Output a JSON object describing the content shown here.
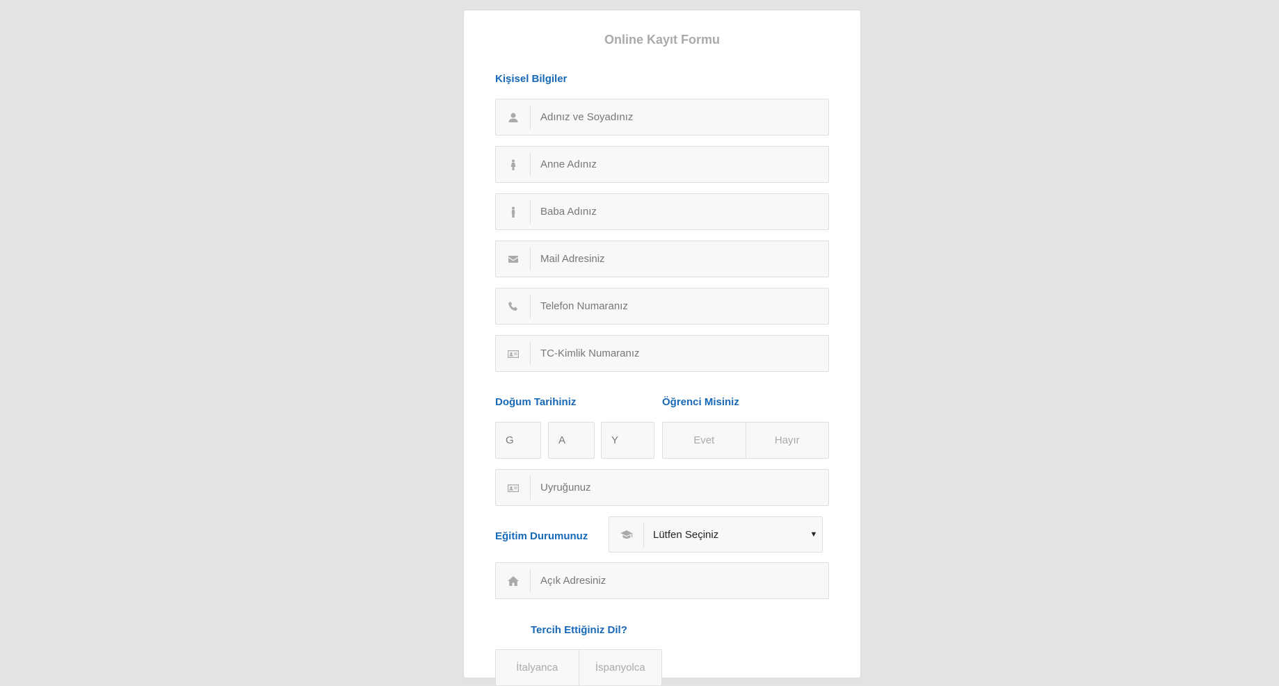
{
  "form": {
    "title": "Online Kayıt Formu",
    "personal_section": "Kişisel Bilgiler",
    "fields": {
      "full_name": "Adınız ve Soyadınız",
      "mother_name": "Anne Adınız",
      "father_name": "Baba Adınız",
      "email": "Mail Adresiniz",
      "phone": "Telefon Numaranız",
      "tc_id": "TC-Kimlik Numaranız",
      "nationality": "Uyruğunuz",
      "address": "Açık Adresiniz"
    },
    "birth_date": {
      "label": "Doğum Tarihiniz",
      "day": "G",
      "month": "A",
      "year": "Y"
    },
    "student": {
      "label": "Öğrenci Misiniz",
      "yes": "Evet",
      "no": "Hayır"
    },
    "education": {
      "label": "Eğitim Durumunuz",
      "selected": "Lütfen Seçiniz"
    },
    "language": {
      "label": "Tercih Ettiğiniz Dil?",
      "options": [
        "İtalyanca",
        "İspanyolca"
      ]
    }
  }
}
